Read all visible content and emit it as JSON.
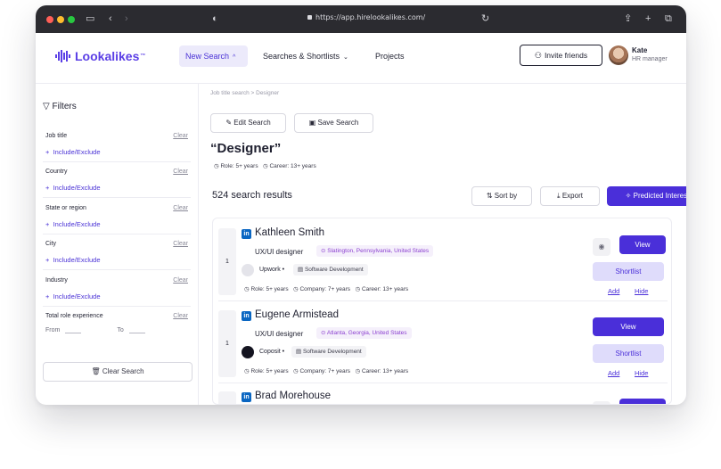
{
  "browser": {
    "url": "https://app.hirelookalikes.com/"
  },
  "header": {
    "logo": "Lookalikes",
    "logo_tm": "™",
    "nav": [
      "New Search",
      "Searches & Shortlists",
      "Projects"
    ],
    "invite_label": "Invite friends",
    "user_name": "Kate",
    "user_role": "HR manager"
  },
  "sidebar": {
    "title": "Filters",
    "clear_label": "Clear",
    "include_label": "Include/Exclude",
    "groups": [
      "Job title",
      "Country",
      "State or region",
      "City",
      "Industry",
      "Total role experience"
    ],
    "from_label": "From",
    "to_label": "To",
    "clear_search": "Clear Search"
  },
  "main": {
    "breadcrumb": "Job title search  >  Designer",
    "edit_search": "Edit Search",
    "save_search": "Save Search",
    "title": "“Designer”",
    "role_meta": "Role: 5+ years",
    "career_meta": "Career: 13+ years",
    "results_count": "524 search results",
    "sort_label": "Sort by",
    "export_label": "Export",
    "predicted_label": "Predicted Interest"
  },
  "candidates": [
    {
      "rank": "1",
      "name": "Kathleen Smith",
      "role": "UX/UI designer",
      "location": "Slatington, Pennsylvania, United States",
      "company": "Upwork",
      "industry": "Software Development",
      "exp_role": "Role: 5+ years",
      "exp_company": "Company: 7+ years",
      "exp_career": "Career: 13+ years"
    },
    {
      "rank": "1",
      "name": "Eugene Armistead",
      "role": "UX/UI designer",
      "location": "Atlanta, Georgia, United States",
      "company": "Coposit",
      "industry": "Software Development",
      "exp_role": "Role: 5+ years",
      "exp_company": "Company: 7+ years",
      "exp_career": "Career: 13+ years"
    },
    {
      "name": "Brad Morehouse"
    }
  ],
  "card_actions": {
    "view": "View",
    "shortlist": "Shortlist",
    "add": "Add",
    "hide": "Hide"
  },
  "colors": {
    "accent": "#4a2fd9",
    "linkedin": "#0a66c2",
    "location": "#8b3fd0"
  }
}
